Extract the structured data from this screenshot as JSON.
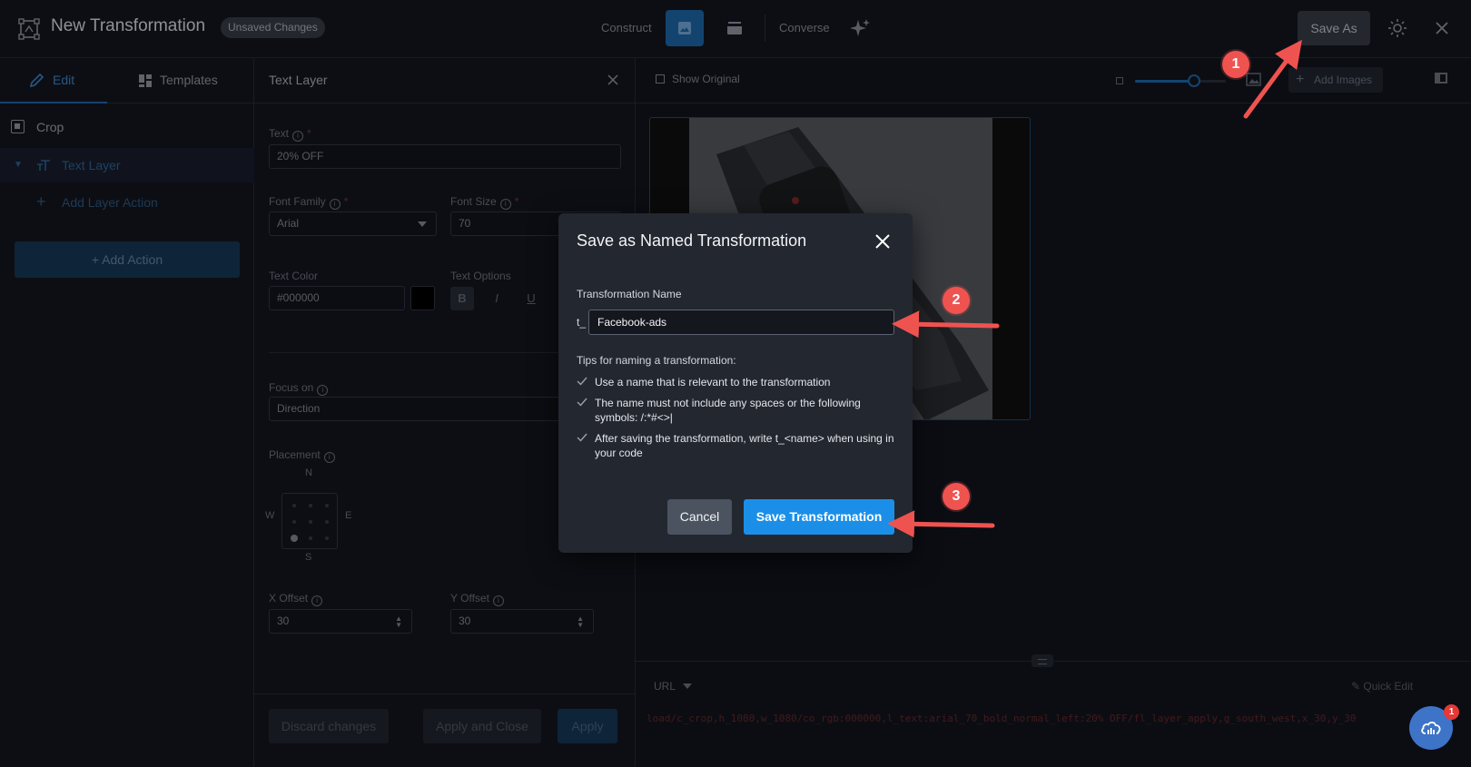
{
  "header": {
    "title": "New Transformation",
    "badge": "Unsaved Changes",
    "construct_label": "Construct",
    "converse_label": "Converse",
    "save_as_label": "Save As"
  },
  "left_panel": {
    "tabs": [
      {
        "label": "Edit",
        "icon": "pencil-icon",
        "active": true
      },
      {
        "label": "Templates",
        "icon": "grid-icon",
        "active": false
      }
    ],
    "items": [
      {
        "label": "Crop",
        "icon": "crop-icon"
      },
      {
        "label": "Text Layer",
        "icon": "text-icon"
      },
      {
        "label": "Add Layer Action",
        "icon": "plus-icon"
      }
    ],
    "add_action_label": "+ Add Action"
  },
  "text_layer_panel": {
    "title": "Text Layer",
    "text_label": "Text",
    "text_value": "20% OFF",
    "font_family_label": "Font Family",
    "font_family_value": "Arial",
    "font_size_label": "Font Size",
    "font_size_value": "70",
    "text_color_label": "Text Color",
    "text_color_value": "#000000",
    "text_options_label": "Text Options",
    "text_options": [
      "B",
      "I",
      "U"
    ],
    "focus_on_label": "Focus on",
    "focus_on_value": "Direction",
    "placement_label": "Placement",
    "compass": {
      "n": "N",
      "s": "S",
      "w": "W",
      "e": "E"
    },
    "x_offset_label": "X Offset",
    "x_offset_value": "30",
    "y_offset_label": "Y Offset",
    "y_offset_value": "30",
    "buttons": {
      "discard": "Discard changes",
      "apply_close": "Apply and Close",
      "apply": "Apply"
    }
  },
  "preview": {
    "show_original_label": "Show Original",
    "add_images_label": "Add Images",
    "zoom_level": 0.65,
    "url_mode": "URL",
    "quick_edit_label": "Quick Edit",
    "url": "load/c_crop,h_1080,w_1080/co_rgb:000000,l_text:arial_70_bold_normal_left:20% OFF/fl_layer_apply,g_south_west,x_30,y_30"
  },
  "modal": {
    "title": "Save as Named Transformation",
    "name_label": "Transformation Name",
    "prefix": "t_",
    "name_value": "Facebook-ads",
    "tips_title": "Tips for naming a transformation:",
    "tips": [
      "Use a name that is relevant to the transformation",
      "The name must not include any spaces or the following symbols: /:*#<>|",
      "After saving the transformation, write t_<name> when using in your code"
    ],
    "cancel_label": "Cancel",
    "save_label": "Save Transformation"
  },
  "annotations": {
    "steps": [
      "1",
      "2",
      "3"
    ],
    "color": "#ef5350"
  },
  "chat": {
    "badge_count": "1"
  },
  "colors": {
    "accent": "#1b8fe8",
    "background": "#151821"
  }
}
